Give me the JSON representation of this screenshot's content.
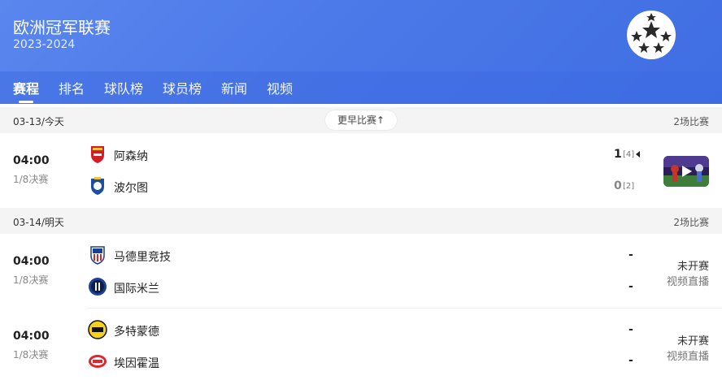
{
  "header": {
    "league_name": "欧洲冠军联赛",
    "season": "2023-2024",
    "logo_icon": "champions-league-ball-icon"
  },
  "tabs": [
    {
      "label": "赛程",
      "active": true
    },
    {
      "label": "排名",
      "active": false
    },
    {
      "label": "球队榜",
      "active": false
    },
    {
      "label": "球员榜",
      "active": false
    },
    {
      "label": "新闻",
      "active": false
    },
    {
      "label": "视频",
      "active": false
    }
  ],
  "days": [
    {
      "date": "03-13/今天",
      "earlier_button": "更早比赛↑",
      "count": "2场比赛",
      "matches": [
        {
          "time": "04:00",
          "round": "1/8决赛",
          "home": {
            "name": "阿森纳",
            "score": "1",
            "penalty": "[4]",
            "icon": "arsenal-crest-icon"
          },
          "away": {
            "name": "波尔图",
            "score": "0",
            "penalty": "[2]",
            "icon": "porto-crest-icon"
          },
          "winner_marker": "winner-arrow-icon",
          "video_thumbnail": "highlight-video-thumbnail"
        }
      ]
    },
    {
      "date": "03-14/明天",
      "count": "2场比赛",
      "matches": [
        {
          "time": "04:00",
          "round": "1/8决赛",
          "home": {
            "name": "马德里竞技",
            "score": "-",
            "icon": "atletico-madrid-crest-icon"
          },
          "away": {
            "name": "国际米兰",
            "score": "-",
            "icon": "inter-milan-crest-icon"
          },
          "status": "未开赛",
          "live_link": "视频直播"
        },
        {
          "time": "04:00",
          "round": "1/8决赛",
          "home": {
            "name": "多特蒙德",
            "score": "-",
            "icon": "dortmund-crest-icon"
          },
          "away": {
            "name": "埃因霍温",
            "score": "-",
            "icon": "psv-crest-icon"
          },
          "status": "未开赛",
          "live_link": "视频直播"
        }
      ]
    }
  ],
  "colors": {
    "header_gradient_start": "#5a86ee",
    "header_gradient_end": "#3f6ee3",
    "date_bar_bg": "#f4f4f5"
  }
}
